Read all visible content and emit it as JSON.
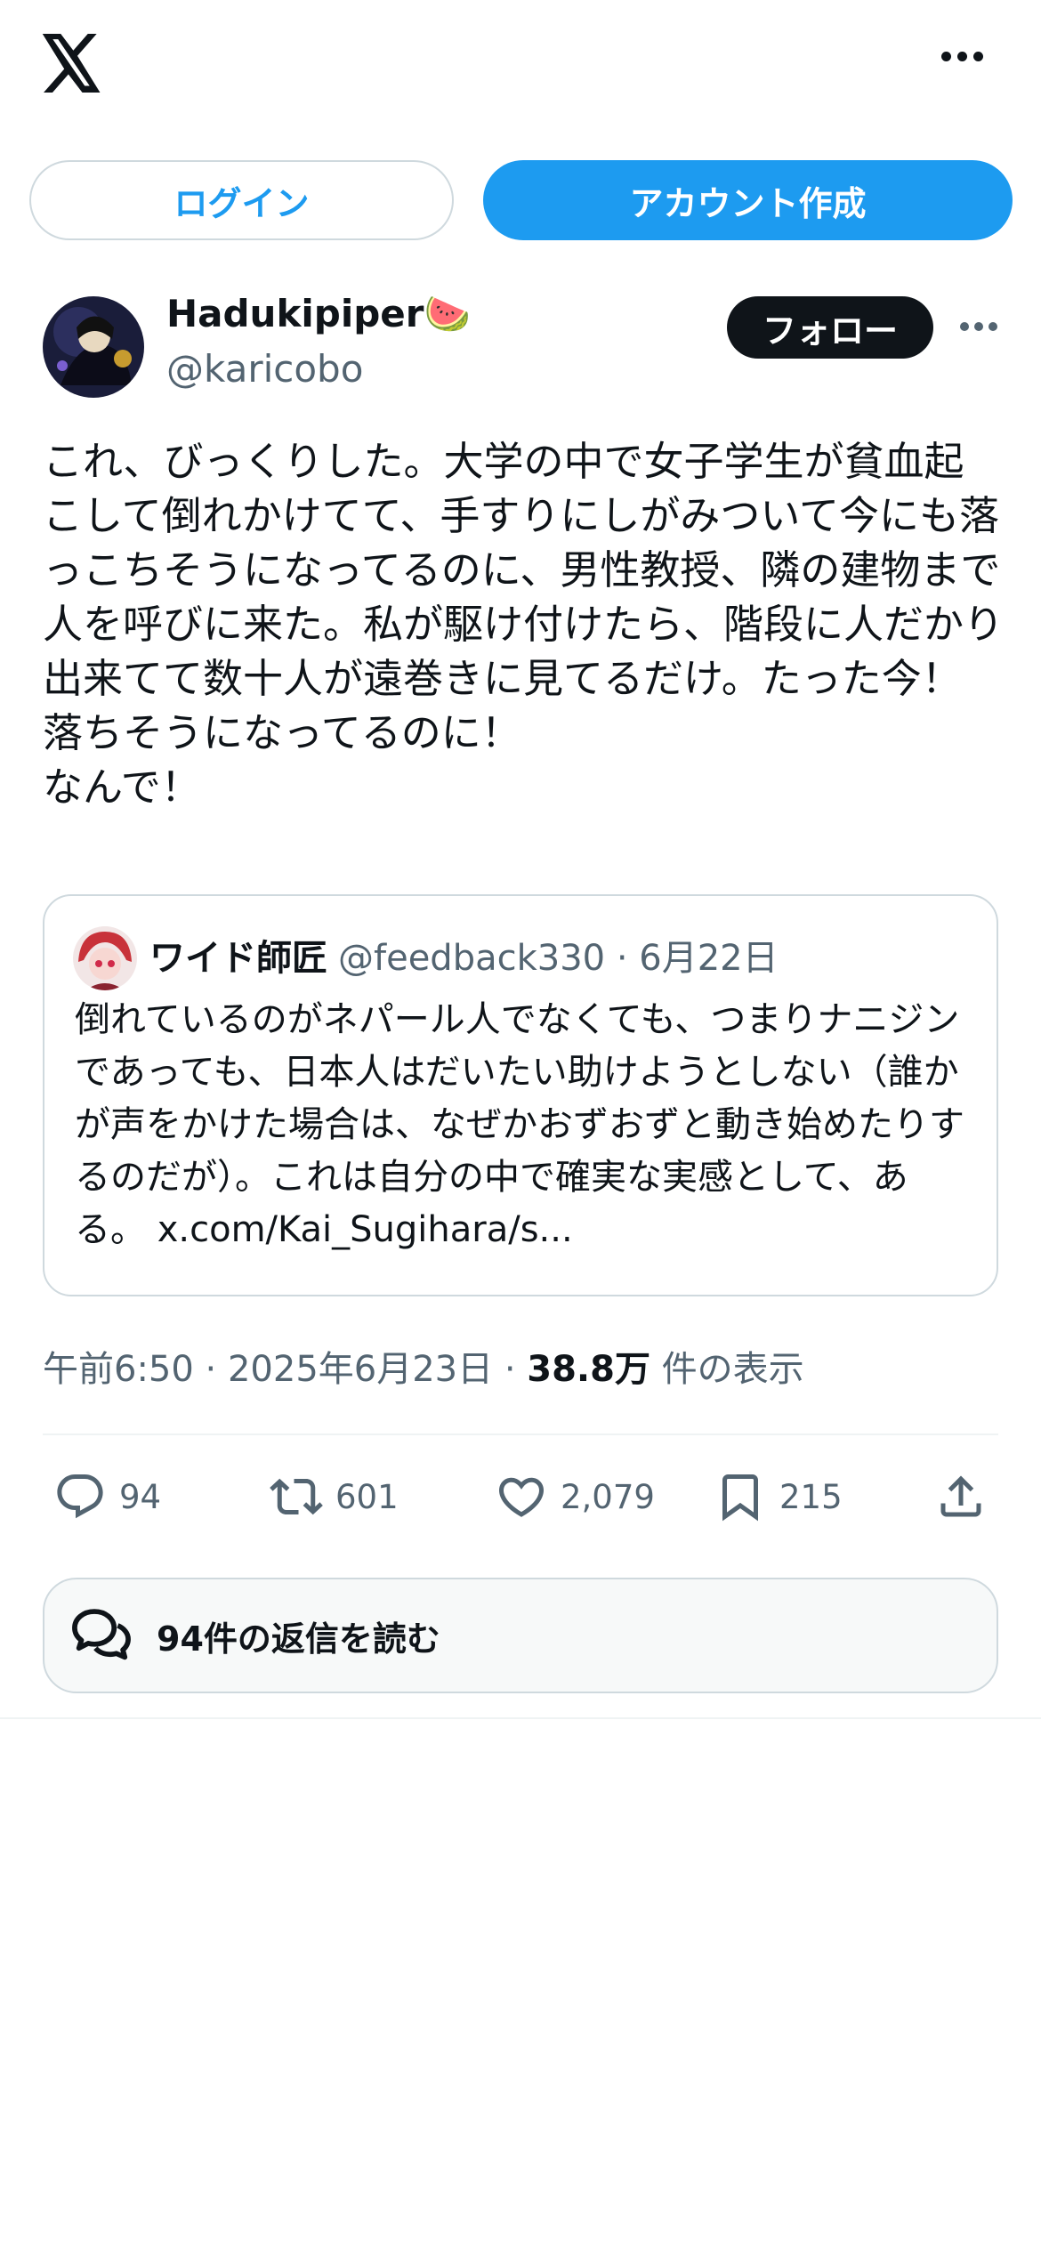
{
  "header": {
    "logo_icon": "x-logo-icon",
    "more_icon": "more-horizontal-icon"
  },
  "auth": {
    "login_label": "ログイン",
    "signup_label": "アカウント作成"
  },
  "tweet": {
    "author": {
      "display_name": "Hadukipiper🍉",
      "handle": "@karicobo"
    },
    "follow_label": "フォロー",
    "text": "これ、びっくりした。大学の中で女子学生が貧血起こして倒れかけてて、手すりにしがみついて今にも落っこちそうになってるのに、男性教授、隣の建物まで人を呼びに来た。私が駆け付けたら、階段に人だかり出来てて数十人が遠巻きに見てるだけ。たった今！　落ちそうになってるのに！\nなんで！",
    "quote": {
      "name": "ワイド師匠",
      "meta": "@feedback330 · 6月22日",
      "text": "倒れているのがネパール人でなくても、つまりナニジンであっても、日本人はだいたい助けようとしない（誰かが声をかけた場合は、なぜかおずおずと動き始めたりするのだが）。これは自分の中で確実な実感として、ある。 x.com/Kai_Sugihara/s..."
    },
    "time": "午前6:50 · 2025年6月23日 · ",
    "views_count": "38.8万",
    "views_label": " 件の表示",
    "stats": {
      "replies": "94",
      "retweets": "601",
      "likes": "2,079",
      "bookmarks": "215"
    },
    "read_replies_label": "94件の返信を読む"
  },
  "colors": {
    "accent": "#1d9bf0",
    "text": "#0f1419",
    "secondary": "#536471",
    "border": "#cfd9de"
  }
}
